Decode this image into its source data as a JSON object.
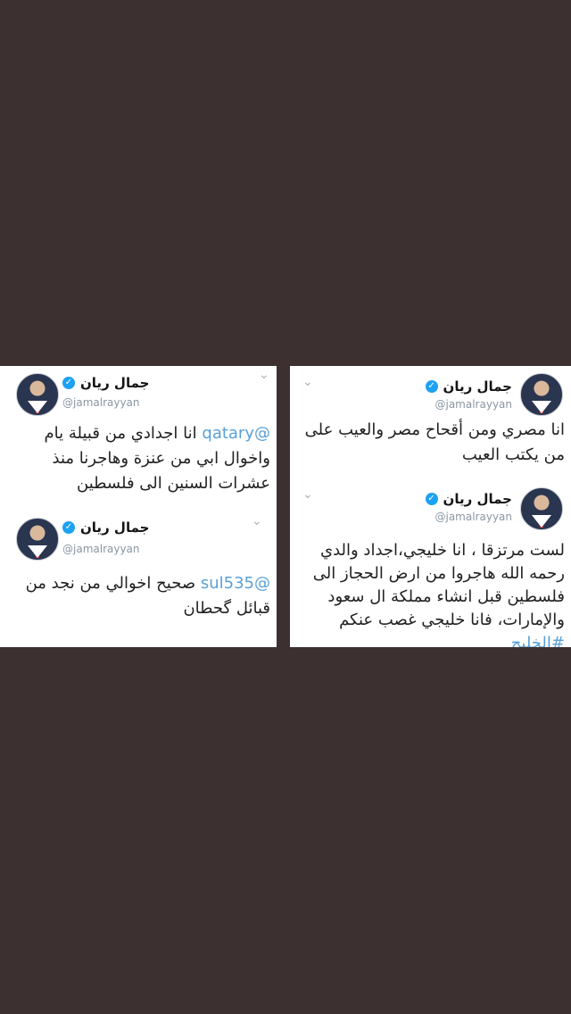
{
  "tweets": {
    "left_top": {
      "name": "جمال ريان",
      "handle": "@jamalrayyan",
      "mention": "@qatary",
      "text": "انا اجدادي من قبيلة يام واخوال ابي من عنزة وهاجرنا منذ عشرات السنين الى فلسطين"
    },
    "left_bottom": {
      "name": "جمال ريان",
      "handle": "@jamalrayyan",
      "mention": "@sul535",
      "text": "صحيح اخوالي من نجد من قبائل گحطان"
    },
    "right_top": {
      "name": "جمال ريان",
      "handle": "@jamalrayyan",
      "text": "انا مصري ومن أقحاح مصر والعيب على من يكتب العيب"
    },
    "right_bottom": {
      "name": "جمال ريان",
      "handle": "@jamalrayyan",
      "text": "لست مرتزقا ، انا خليجي،اجداد والدي رحمه الله هاجروا من ارض الحجاز الى فلسطين قبل انشاء مملكة ال سعود والإمارات، فانا خليجي غصب عنكم",
      "hashtag": "#الخليج"
    }
  },
  "icons": {
    "verified": "verified-badge-icon",
    "chevron": "chevron-down-icon"
  },
  "colors": {
    "background": "#3d3030",
    "link": "#5aa0d8",
    "verified": "#1da1f2"
  }
}
